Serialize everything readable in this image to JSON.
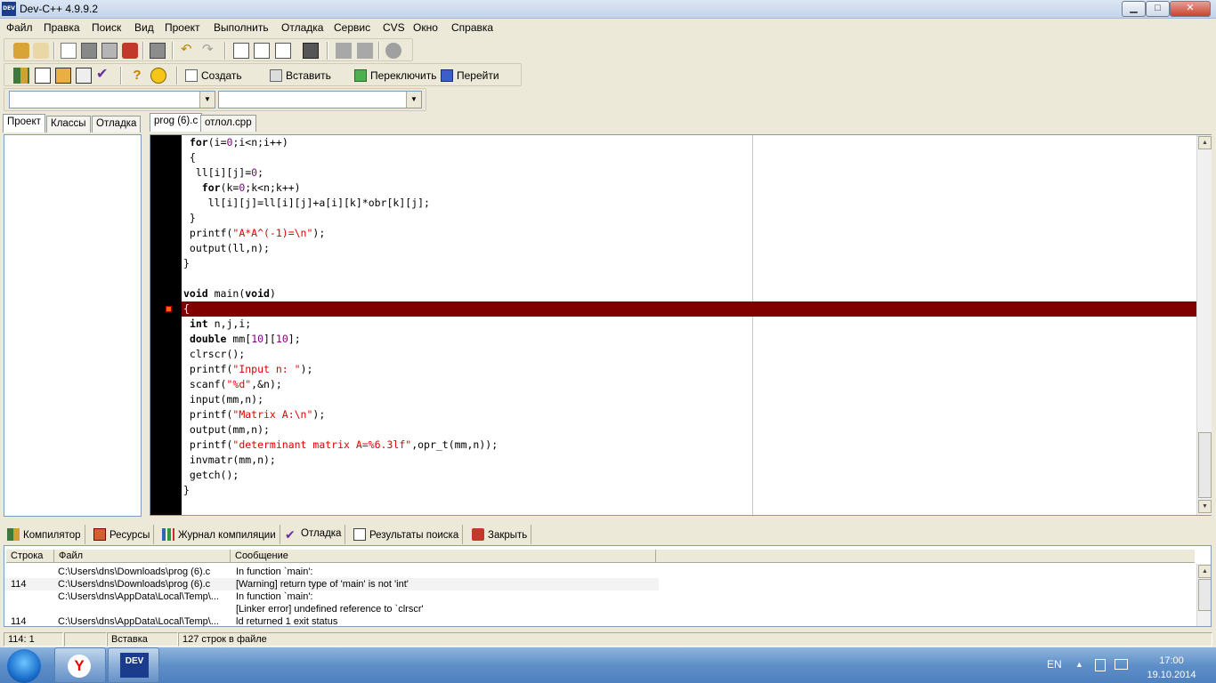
{
  "window": {
    "title": "Dev-C++ 4.9.9.2",
    "icon_label": "DEV",
    "min": "▁",
    "max": "□",
    "close": "✕"
  },
  "menu": [
    "Файл",
    "Правка",
    "Поиск",
    "Вид",
    "Проект",
    "Выполнить",
    "Отладка",
    "Сервис",
    "CVS",
    "Окно",
    "Справка"
  ],
  "toolbar2": {
    "create": "Создать",
    "insert": "Вставить",
    "toggle": "Переключить",
    "goto": "Перейти"
  },
  "left_tabs": [
    "Проект",
    "Классы",
    "Отладка"
  ],
  "editor_tabs": [
    "prog (6).c",
    "отлол.cpp"
  ],
  "code_lines": [
    [
      {
        "t": " ",
        "c": ""
      },
      {
        "t": "for",
        "c": "kw"
      },
      {
        "t": "(i=",
        "c": ""
      },
      {
        "t": "0",
        "c": "num"
      },
      {
        "t": ";i<n;i++)",
        "c": ""
      }
    ],
    [
      {
        "t": " {",
        "c": ""
      }
    ],
    [
      {
        "t": "  ll[i][j]=",
        "c": ""
      },
      {
        "t": "0",
        "c": "num"
      },
      {
        "t": ";",
        "c": ""
      }
    ],
    [
      {
        "t": "   ",
        "c": ""
      },
      {
        "t": "for",
        "c": "kw"
      },
      {
        "t": "(k=",
        "c": ""
      },
      {
        "t": "0",
        "c": "num"
      },
      {
        "t": ";k<n;k++)",
        "c": ""
      }
    ],
    [
      {
        "t": "    ll[i][j]=ll[i][j]+a[i][k]*obr[k][j];",
        "c": ""
      }
    ],
    [
      {
        "t": " }",
        "c": ""
      }
    ],
    [
      {
        "t": " printf(",
        "c": ""
      },
      {
        "t": "\"A*A^(-1)=\\n\"",
        "c": "str"
      },
      {
        "t": ");",
        "c": ""
      }
    ],
    [
      {
        "t": " output(ll,n);",
        "c": ""
      }
    ],
    [
      {
        "t": "}",
        "c": ""
      }
    ],
    [
      {
        "t": "",
        "c": ""
      }
    ],
    [
      {
        "t": "void",
        "c": "kw"
      },
      {
        "t": " main(",
        "c": ""
      },
      {
        "t": "void",
        "c": "kw"
      },
      {
        "t": ")",
        "c": ""
      }
    ],
    [
      {
        "t": "{",
        "c": "err"
      }
    ],
    [
      {
        "t": " ",
        "c": ""
      },
      {
        "t": "int",
        "c": "kw"
      },
      {
        "t": " n,j,i;",
        "c": ""
      }
    ],
    [
      {
        "t": " ",
        "c": ""
      },
      {
        "t": "double",
        "c": "kw"
      },
      {
        "t": " mm[",
        "c": ""
      },
      {
        "t": "10",
        "c": "num"
      },
      {
        "t": "][",
        "c": ""
      },
      {
        "t": "10",
        "c": "num"
      },
      {
        "t": "];",
        "c": ""
      }
    ],
    [
      {
        "t": " clrscr();",
        "c": ""
      }
    ],
    [
      {
        "t": " printf(",
        "c": ""
      },
      {
        "t": "\"Input n: \"",
        "c": "str"
      },
      {
        "t": ");",
        "c": ""
      }
    ],
    [
      {
        "t": " scanf(",
        "c": ""
      },
      {
        "t": "\"%d\"",
        "c": "str"
      },
      {
        "t": ",&n);",
        "c": ""
      }
    ],
    [
      {
        "t": " input(mm,n);",
        "c": ""
      }
    ],
    [
      {
        "t": " printf(",
        "c": ""
      },
      {
        "t": "\"Matrix A:\\n\"",
        "c": "str"
      },
      {
        "t": ");",
        "c": ""
      }
    ],
    [
      {
        "t": " output(mm,n);",
        "c": ""
      }
    ],
    [
      {
        "t": " printf(",
        "c": ""
      },
      {
        "t": "\"determinant matrix A=%6.3lf\"",
        "c": "str"
      },
      {
        "t": ",opr_t(mm,n));",
        "c": ""
      }
    ],
    [
      {
        "t": " invmatr(mm,n);",
        "c": ""
      }
    ],
    [
      {
        "t": " getch();",
        "c": ""
      }
    ],
    [
      {
        "t": "}",
        "c": ""
      }
    ]
  ],
  "bottom_tabs": [
    "Компилятор",
    "Ресурсы",
    "Журнал компиляции",
    "Отладка",
    "Результаты поиска",
    "Закрыть"
  ],
  "messages": {
    "headers": [
      "Строка",
      "Файл",
      "Сообщение"
    ],
    "rows": [
      [
        "",
        "C:\\Users\\dns\\Downloads\\prog (6).c",
        "In function `main':"
      ],
      [
        "114",
        "C:\\Users\\dns\\Downloads\\prog (6).c",
        "[Warning] return type of 'main' is not 'int'"
      ],
      [
        "",
        "C:\\Users\\dns\\AppData\\Local\\Temp\\...",
        "In function `main':"
      ],
      [
        "",
        "",
        "[Linker error] undefined reference to `clrscr'"
      ],
      [
        "114",
        "C:\\Users\\dns\\AppData\\Local\\Temp\\...",
        "ld returned 1 exit status"
      ]
    ]
  },
  "status": {
    "position": "114: 1",
    "mode": "Вставка",
    "lines": "127 строк в файле"
  },
  "taskbar": {
    "lang": "EN",
    "time": "17:00",
    "date": "19.10.2014",
    "devapp_label": "DEV"
  },
  "colors": {
    "error_line": "#800000",
    "string": "#e00000",
    "number": "#800080"
  }
}
